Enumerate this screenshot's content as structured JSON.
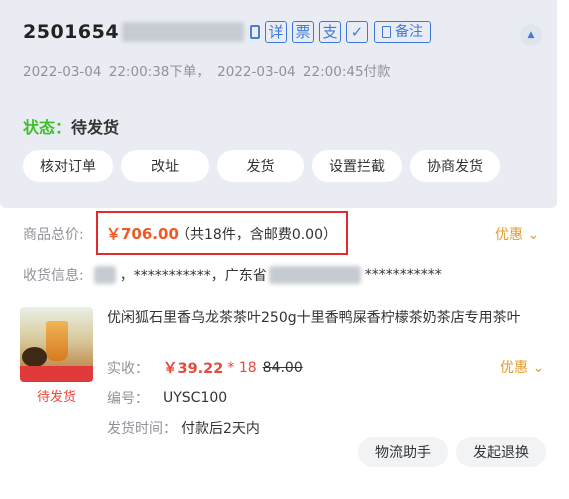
{
  "order": {
    "number": "2501654",
    "tags": [
      "详",
      "票",
      "支"
    ],
    "note_label": "备注",
    "times": "2022-03-04 22:00:38下单，  2022-03-04 22:00:45付款",
    "status_label": "状态：",
    "status_value": "待发货"
  },
  "actions": [
    "核对订单",
    "改址",
    "发货",
    "设置拦截",
    "协商发货"
  ],
  "summary": {
    "total_label": "商品总价:",
    "total_value": "￥706.00",
    "total_extra": "（共18件，含邮费0.00）",
    "discount_label": "优惠",
    "address_label": "收货信息:",
    "address_mid": "，***********，广东省",
    "address_tail": "***********"
  },
  "item": {
    "name": "优闲狐石里香乌龙茶茶叶250g十里香鸭屎香柠檬茶奶茶店专用茶叶",
    "thumb_status": "待发货",
    "paid_label": "实收：",
    "paid_value": "￥39.22",
    "qty": "* 18",
    "orig_price": "84.00",
    "discount_label": "优惠",
    "code_label": "编号：",
    "code_value": "UYSC100",
    "ship_label": "发货时间：",
    "ship_value": "付款后2天内"
  },
  "bottom_buttons": [
    "物流助手",
    "发起退换"
  ],
  "colors": {
    "accent_blue": "#3f79d8",
    "status_green": "#3fbf2b",
    "price_orange": "#ee5a24",
    "discount_gold": "#e49c2d",
    "highlight_red": "#e22a2a"
  }
}
